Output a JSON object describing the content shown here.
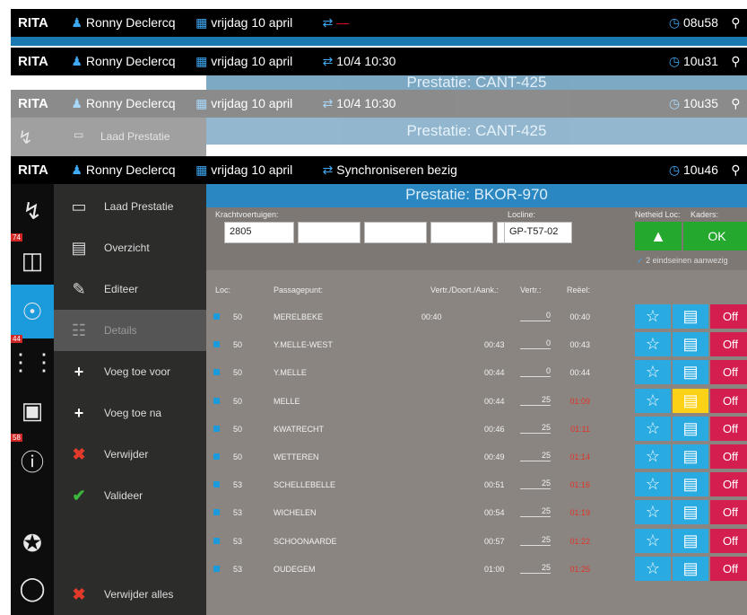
{
  "headers": [
    {
      "app": "RITA",
      "user": "Ronny Declercq",
      "date": "vrijdag 10 april",
      "sync": "",
      "time": "08u58"
    },
    {
      "app": "RITA",
      "user": "Ronny Declercq",
      "date": "vrijdag 10 april",
      "sync": "10/4 10:30",
      "time": "10u31"
    },
    {
      "app": "RITA",
      "user": "Ronny Declercq",
      "date": "vrijdag 10 april",
      "sync": "10/4 10:30",
      "time": "10u35"
    },
    {
      "app": "RITA",
      "user": "Ronny Declercq",
      "date": "vrijdag 10 april",
      "sync": "Synchroniseren bezig",
      "time": "10u46"
    }
  ],
  "ghost": {
    "title_a": "Prestatie: CANT-425",
    "title_b": "Prestatie: CANT-425",
    "menu_item": "Laad Prestatie"
  },
  "title": "Prestatie: BKOR-970",
  "badges": {
    "a": "74",
    "b": "44",
    "c": "58"
  },
  "menu": [
    {
      "label": "Laad Prestatie",
      "icon": "folder-icon"
    },
    {
      "label": "Overzicht",
      "icon": "list-icon"
    },
    {
      "label": "Editeer",
      "icon": "pencil-icon"
    },
    {
      "label": "Details",
      "icon": "search-doc-icon"
    },
    {
      "label": "Voeg toe voor",
      "icon": "plus-icon"
    },
    {
      "label": "Voeg toe na",
      "icon": "plus-icon"
    },
    {
      "label": "Verwijder",
      "icon": "x-icon"
    },
    {
      "label": "Valideer",
      "icon": "check-icon"
    },
    {
      "label": "Verwijder alles",
      "icon": "x-icon"
    }
  ],
  "form": {
    "krachtvoertuigen_label": "Krachtvoertuigen:",
    "krachtvoertuig_1": "2805",
    "locline_label": "Locline:",
    "locline": "GP-T57-02",
    "netheid_label": "Netheid Loc:",
    "kaders_label": "Kaders:",
    "ok": "OK",
    "eindseinen": "2 eindseinen aanwezig"
  },
  "table_headers": {
    "loc": "Loc:",
    "passagepunt": "Passagepunt:",
    "vertr_doort": "Vertr./Doort./Aank.:",
    "vertr": "Vertr.:",
    "reeel": "Reëel:"
  },
  "rows": [
    {
      "loc": "50",
      "punt": "MERELBEKE",
      "vda": "00:40",
      "vertr": "0",
      "reeel": "00:40",
      "late": false,
      "yellow": false
    },
    {
      "loc": "50",
      "punt": "Y.MELLE-WEST",
      "vda": "00:43",
      "vertr": "0",
      "reeel": "00:43",
      "late": false,
      "yellow": false
    },
    {
      "loc": "50",
      "punt": "Y.MELLE",
      "vda": "00:44",
      "vertr": "0",
      "reeel": "00:44",
      "late": false,
      "yellow": false
    },
    {
      "loc": "50",
      "punt": "MELLE",
      "vda": "00:44",
      "vertr": "25",
      "reeel": "01:09",
      "late": true,
      "yellow": true
    },
    {
      "loc": "50",
      "punt": "KWATRECHT",
      "vda": "00:46",
      "vertr": "25",
      "reeel": "01:11",
      "late": true,
      "yellow": false
    },
    {
      "loc": "50",
      "punt": "WETTEREN",
      "vda": "00:49",
      "vertr": "25",
      "reeel": "01:14",
      "late": true,
      "yellow": false
    },
    {
      "loc": "53",
      "punt": "SCHELLEBELLE",
      "vda": "00:51",
      "vertr": "25",
      "reeel": "01:16",
      "late": true,
      "yellow": false
    },
    {
      "loc": "53",
      "punt": "WICHELEN",
      "vda": "00:54",
      "vertr": "25",
      "reeel": "01:19",
      "late": true,
      "yellow": false
    },
    {
      "loc": "53",
      "punt": "SCHOONAARDE",
      "vda": "00:57",
      "vertr": "25",
      "reeel": "01:22",
      "late": true,
      "yellow": false
    },
    {
      "loc": "53",
      "punt": "OUDEGEM",
      "vda": "01:00",
      "vertr": "25",
      "reeel": "01:25",
      "late": true,
      "yellow": false
    }
  ],
  "off_label": "Off",
  "colors": {
    "accent": "#1b9bdb",
    "ok": "#25a82e",
    "off": "#d41e50",
    "late": "#e0342a",
    "highlight": "#fcd116"
  }
}
